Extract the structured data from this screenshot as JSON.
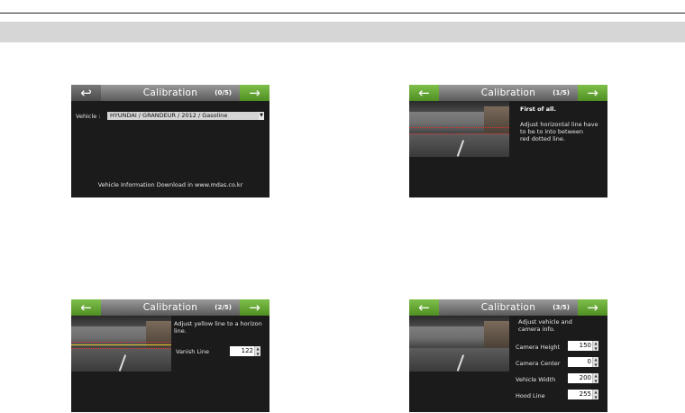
{
  "screens": {
    "s0": {
      "title": "Calibration",
      "step": "(0/5)",
      "vehicle_label": "Vehicle :",
      "vehicle_value": "HYUNDAI / GRANDEUR / 2012 / Gasoline",
      "footer": "Vehicle Information Download in www.mdas.co.kr"
    },
    "s1": {
      "title": "Calibration",
      "step": "(1/5)",
      "heading": "First of all.",
      "line1": "Adjust horizontal line have",
      "line2": "to be to into between",
      "line3": "red dotted line."
    },
    "s2": {
      "title": "Calibration",
      "step": "(2/5)",
      "line1": "Adjust yellow line to a horizon",
      "line2": "line.",
      "vanish_label": "Vanish Line",
      "vanish_value": "122"
    },
    "s3": {
      "title": "Calibration",
      "step": "(3/5)",
      "line1": "Adjust vehicle and",
      "line2": "camera info.",
      "camera_height_label": "Camera Height",
      "camera_height_value": "150",
      "camera_center_label": "Camera Center",
      "camera_center_value": "0",
      "vehicle_width_label": "Vehicle Width",
      "vehicle_width_value": "200",
      "hood_line_label": "Hood Line",
      "hood_line_value": "255"
    }
  },
  "icons": {
    "return": "↩",
    "arrow_left": "←",
    "arrow_right": "→",
    "dropdown": "▼",
    "up": "▲",
    "down": "▼"
  },
  "colors": {
    "green": "#5a9e2c",
    "header": "#7a7a7a",
    "screen_bg": "#1b1b1b"
  }
}
